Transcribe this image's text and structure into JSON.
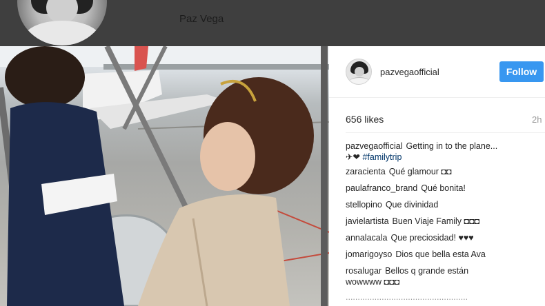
{
  "top_bar": {
    "name": "Paz Vega"
  },
  "post": {
    "username": "pazvegaofficial",
    "follow_label": "Follow",
    "likes": "656 likes",
    "time": "2h",
    "caption": {
      "user": "pazvegaofficial",
      "text": "Getting in to the plane...",
      "emoji": "✈❤",
      "hashtag": "#familytrip"
    },
    "comments": [
      {
        "user": "zaracienta",
        "text": "Qué glamour ◘◘"
      },
      {
        "user": "paulafranco_brand",
        "text": "Qué bonita!"
      },
      {
        "user": "stellopino",
        "text": "Que divinidad"
      },
      {
        "user": "javielartista",
        "text": "Buen Viaje Family ◘◘◘"
      },
      {
        "user": "annalacala",
        "text": "Que preciosidad! ♥♥♥"
      },
      {
        "user": "jomarigoyso",
        "text": "Dios que bella esta Ava"
      },
      {
        "user": "rosalugar",
        "text": "Bellos q grande están"
      },
      {
        "user": "",
        "text": "wowwww ◘◘◘"
      }
    ],
    "partial_comment": "..................................................."
  }
}
